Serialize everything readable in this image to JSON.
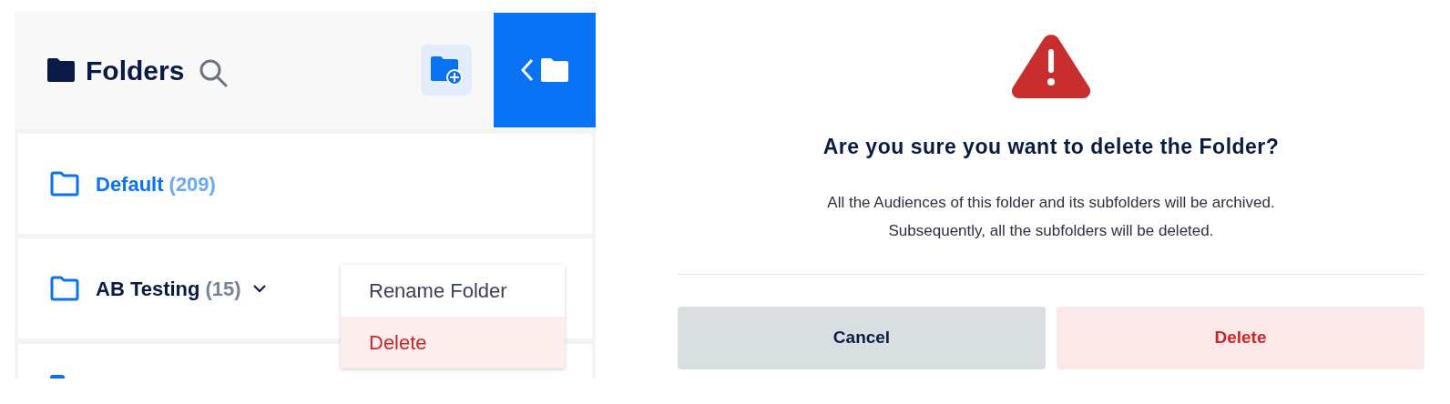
{
  "folders_panel": {
    "title": "Folders",
    "folders": [
      {
        "name": "Default",
        "count": "(209)",
        "selected": true,
        "has_children": false
      },
      {
        "name": "AB Testing",
        "count": "(15)",
        "selected": false,
        "has_children": true
      },
      {
        "kind": "partial"
      }
    ],
    "context_menu": [
      {
        "label": "Rename Folder",
        "kind": "normal",
        "highlighted": false
      },
      {
        "label": "Delete",
        "kind": "danger",
        "highlighted": true
      }
    ]
  },
  "dialog": {
    "title": "Are you sure you want to delete the Folder?",
    "message_lines": [
      "All the Audiences of this folder and its subfolders will be archived.",
      "Subsequently, all the subfolders will be deleted."
    ],
    "buttons": [
      {
        "label": "Cancel",
        "kind": "secondary"
      },
      {
        "label": "Delete",
        "kind": "danger"
      }
    ]
  }
}
